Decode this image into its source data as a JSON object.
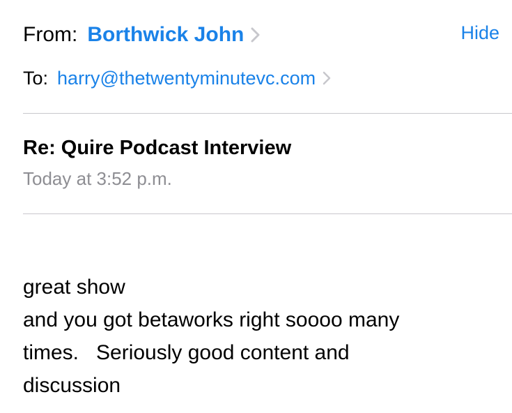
{
  "header": {
    "from_label": "From:",
    "from_name": "Borthwick John",
    "to_label": "To:",
    "to_address": "harry@thetwentyminutevc.com",
    "hide_label": "Hide"
  },
  "message": {
    "subject": "Re: Quire Podcast Interview",
    "date": "Today at 3:52 p.m.",
    "body_lines": [
      "great show",
      "and you got betaworks right soooo many",
      "times.   Seriously good content and",
      "discussion"
    ]
  },
  "icons": {
    "from_chevron": "chevron-right-icon",
    "to_chevron": "chevron-right-icon"
  },
  "colors": {
    "accent": "#1a82e8",
    "secondary_text": "#8e8e93",
    "chevron": "#c7c7cc",
    "divider": "#c8c7cc"
  }
}
